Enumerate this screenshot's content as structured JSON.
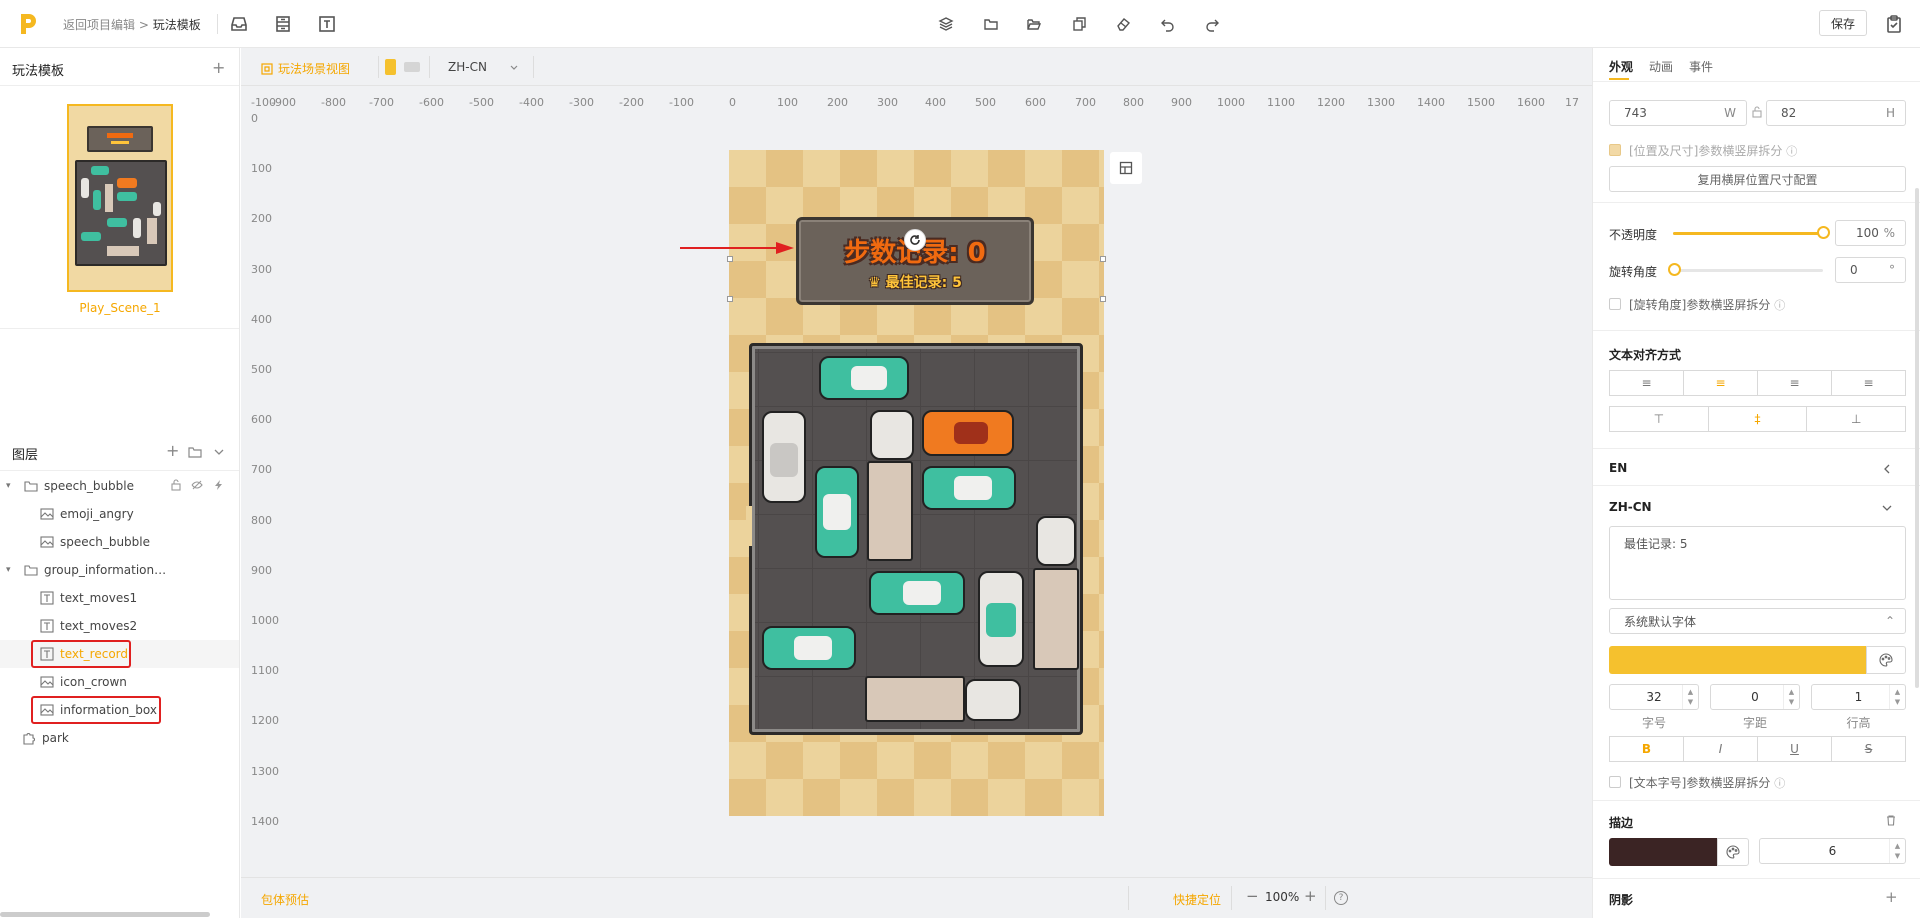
{
  "topbar": {
    "breadcrumb_back": "返回项目编辑",
    "breadcrumb_sep": ">",
    "breadcrumb_current": "玩法模板",
    "save_label": "保存"
  },
  "left": {
    "templates_title": "玩法模板",
    "scene_name": "Play_Scene_1",
    "layers_title": "图层",
    "layers": [
      {
        "label": "speech_bubble",
        "type": "folder",
        "level": 0
      },
      {
        "label": "emoji_angry",
        "type": "image",
        "level": 1
      },
      {
        "label": "speech_bubble",
        "type": "image",
        "level": 1
      },
      {
        "label": "group_information…",
        "type": "folder",
        "level": 0
      },
      {
        "label": "text_moves1",
        "type": "text",
        "level": 1
      },
      {
        "label": "text_moves2",
        "type": "text",
        "level": 1
      },
      {
        "label": "text_record",
        "type": "text",
        "level": 1,
        "selected": true
      },
      {
        "label": "icon_crown",
        "type": "image",
        "level": 1
      },
      {
        "label": "information_box",
        "type": "image",
        "level": 1
      },
      {
        "label": "park",
        "type": "puzzle",
        "level": 0
      }
    ]
  },
  "canvas": {
    "scene_view_label": "玩法场景视图",
    "language": "ZH-CN",
    "ruler_top": [
      "-100",
      "-900",
      "-800",
      "-700",
      "-600",
      "-500",
      "-400",
      "-300",
      "-200",
      "-100",
      "0",
      "100",
      "200",
      "300",
      "400",
      "500",
      "600",
      "700",
      "800",
      "900",
      "1000",
      "1100",
      "1200",
      "1300",
      "1400",
      "1500",
      "1600",
      "17"
    ],
    "ruler_left": [
      "0",
      "100",
      "200",
      "300",
      "400",
      "500",
      "600",
      "700",
      "800",
      "900",
      "1000",
      "1100",
      "1200",
      "1300",
      "1400"
    ],
    "moves_text": "步数记录: 0",
    "record_text": "最佳记录: 5",
    "bundle_preview": "包体预估",
    "quick_locate": "快捷定位",
    "zoom": "100%"
  },
  "right": {
    "tabs": [
      "外观",
      "动画",
      "事件"
    ],
    "width_value": "743",
    "width_suffix": "W",
    "height_value": "82",
    "height_suffix": "H",
    "pos_split_label": "[位置及尺寸]参数横竖屏拆分",
    "reuse_label": "复用横屏位置尺寸配置",
    "opacity_label": "不透明度",
    "opacity_value": "100",
    "opacity_unit": "%",
    "opacity_level": 1.0,
    "rotate_label": "旋转角度",
    "rotate_value": "0",
    "rotate_unit": "°",
    "rotate_split_label": "[旋转角度]参数横竖屏拆分",
    "align_title": "文本对齐方式",
    "lang_en": "EN",
    "lang_zh": "ZH-CN",
    "text_value": "最佳记录: 5",
    "font_label": "系统默认字体",
    "text_color": "#F5C12E",
    "font_size": "32",
    "letter_spacing": "0",
    "line_height": "1",
    "font_size_label": "字号",
    "letter_spacing_label": "字距",
    "line_height_label": "行高",
    "style_buttons": [
      "B",
      "I",
      "U",
      "S"
    ],
    "font_split_label": "[文本字号]参数横竖屏拆分",
    "stroke_title": "描边",
    "stroke_color": "#3B2424",
    "stroke_width": "6",
    "shadow_title": "阴影"
  },
  "colors": {
    "accent": "#F5B820",
    "highlight_box": "#E02020"
  }
}
